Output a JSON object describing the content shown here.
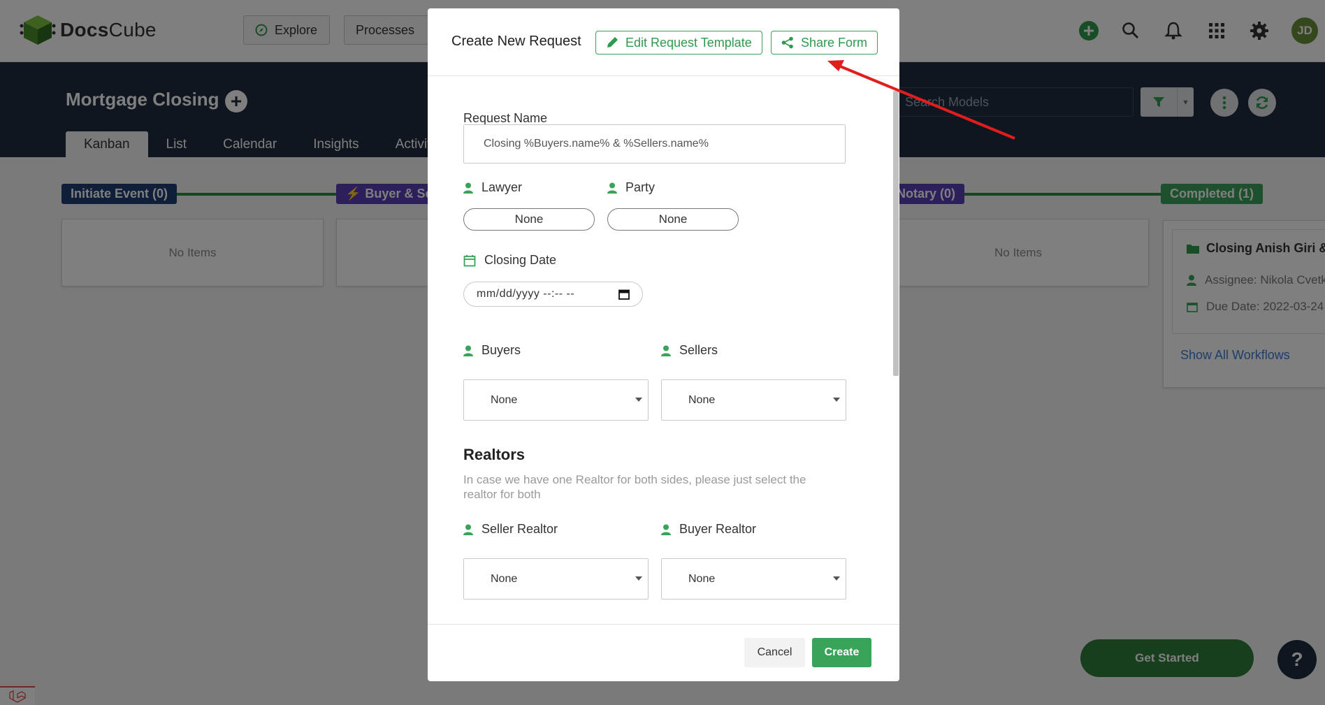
{
  "app": {
    "logo_prefix": "Docs",
    "logo_suffix": "Cube",
    "nav": [
      {
        "label": "Explore",
        "icon": "compass-icon"
      },
      {
        "label": "Processes"
      }
    ],
    "top_icons": [
      "add-icon",
      "search-icon",
      "bell-icon",
      "apps-grid-icon",
      "gear-icon"
    ],
    "avatar_initials": "JD"
  },
  "board": {
    "title": "Mortgage Closing",
    "tabs": [
      "Kanban",
      "List",
      "Calendar",
      "Insights",
      "Activity"
    ],
    "active_tab": "Kanban",
    "search_placeholder": "Search Models"
  },
  "stages": [
    {
      "label": "Initiate Event (0)",
      "color": "#1f3f73"
    },
    {
      "label": "Buyer & Sel",
      "color": "#5b3fb8"
    },
    {
      "label": "Notary (0)",
      "color": "#5b3fb8"
    },
    {
      "label": "Completed (1)",
      "color": "#3aa35a"
    }
  ],
  "columns": {
    "empty_text": "No Items"
  },
  "card": {
    "title": "Closing Anish Giri & M",
    "assignee": "Assignee: Nikola Cvetk",
    "due_date": "Due Date: 2022-03-24",
    "show_all": "Show All Workflows"
  },
  "floating": {
    "get_started": "Get Started",
    "help": "?"
  },
  "modal": {
    "title": "Create New Request",
    "edit_template": "Edit Request Template",
    "share_form": "Share Form",
    "request_name_label": "Request Name",
    "request_name_value": "Closing %Buyers.name% & %Sellers.name%",
    "lawyer_label": "Lawyer",
    "lawyer_value": "None",
    "party_label": "Party",
    "party_value": "None",
    "closing_date_label": "Closing Date",
    "closing_date_value": "mm/dd/yyyy --:-- --",
    "buyers_label": "Buyers",
    "buyers_value": "None",
    "sellers_label": "Sellers",
    "sellers_value": "None",
    "realtors_title": "Realtors",
    "realtors_desc": "In case we have one Realtor for both sides, please just select the realtor for both",
    "seller_realtor_label": "Seller Realtor",
    "seller_realtor_value": "None",
    "buyer_realtor_label": "Buyer Realtor",
    "buyer_realtor_value": "None",
    "cancel": "Cancel",
    "create": "Create"
  },
  "colors": {
    "accent": "#3aa35a",
    "dark_header": "#1e2c3f",
    "annotation_arrow": "#e11d1d"
  }
}
